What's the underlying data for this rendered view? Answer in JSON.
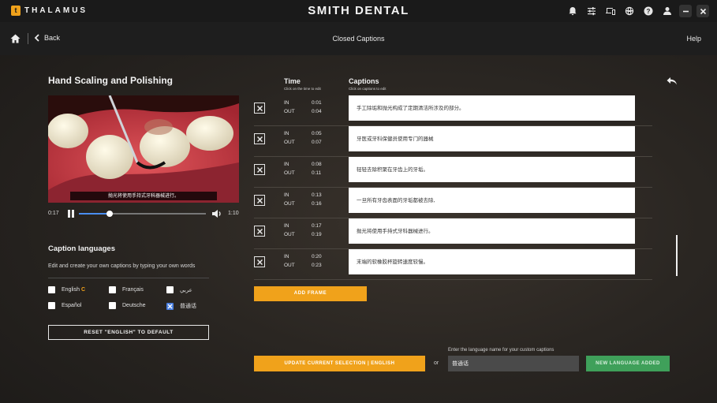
{
  "app": {
    "brand_badge": "t",
    "brand_name": "THALAMUS",
    "title": "SMITH DENTAL",
    "icons": [
      "bell-icon",
      "sliders-icon",
      "devices-icon",
      "globe-icon",
      "help-icon",
      "user-icon"
    ]
  },
  "nav": {
    "back_label": "Back",
    "title": "Closed Captions",
    "help_label": "Help"
  },
  "video": {
    "title": "Hand Scaling and Polishing",
    "subtitle": "抛光将使用手持式牙科器械进行。",
    "current_time": "0:17",
    "duration": "1:10",
    "progress": 0.24
  },
  "languages": {
    "heading": "Caption languages",
    "description": "Edit and create your own captions by typing your own words",
    "items": [
      {
        "label": "English",
        "checked": false,
        "badge": "C"
      },
      {
        "label": "Français",
        "checked": false
      },
      {
        "label": "عربي",
        "checked": false
      },
      {
        "label": "Español",
        "checked": false
      },
      {
        "label": "Deutsche",
        "checked": false
      },
      {
        "label": "普通话",
        "checked": true
      }
    ],
    "reset_label": "RESET \"ENGLISH\" TO DEFAULT"
  },
  "editor": {
    "time_header": "Time",
    "time_sub": "Click on the time to edit",
    "captions_header": "Captions",
    "captions_sub": "Click on captions to edit",
    "in_label": "IN",
    "out_label": "OUT",
    "rows": [
      {
        "in": "0:01",
        "out": "0:04",
        "caption": "手工除垢和抛光构成了定期清洁所涉及的部分。"
      },
      {
        "in": "0:05",
        "out": "0:07",
        "caption": "牙医或牙科保健员使用专门的器械"
      },
      {
        "in": "0:08",
        "out": "0:11",
        "caption": "轻轻去除积聚在牙齿上的牙垢。"
      },
      {
        "in": "0:13",
        "out": "0:16",
        "caption": "一旦所有牙齿表面的牙垢都被去除,"
      },
      {
        "in": "0:17",
        "out": "0:19",
        "caption": "抛光将使用手持式牙科器械进行。"
      },
      {
        "in": "0:20",
        "out": "0:23",
        "caption": "末端的软橡胶杯旋转速度较慢。"
      }
    ],
    "add_frame_label": "ADD FRAME",
    "update_label": "UPDATE CURRENT SELECTION  |  ENGLISH",
    "or_label": "or",
    "name_field_label": "Enter the language name for your custom captions",
    "name_field_value": "普通话",
    "new_language_label": "NEW LANGUAGE ADDED"
  },
  "colors": {
    "accent": "#f0a21b",
    "success": "#3fa05a",
    "checkbox_active": "#4a7fe0"
  }
}
